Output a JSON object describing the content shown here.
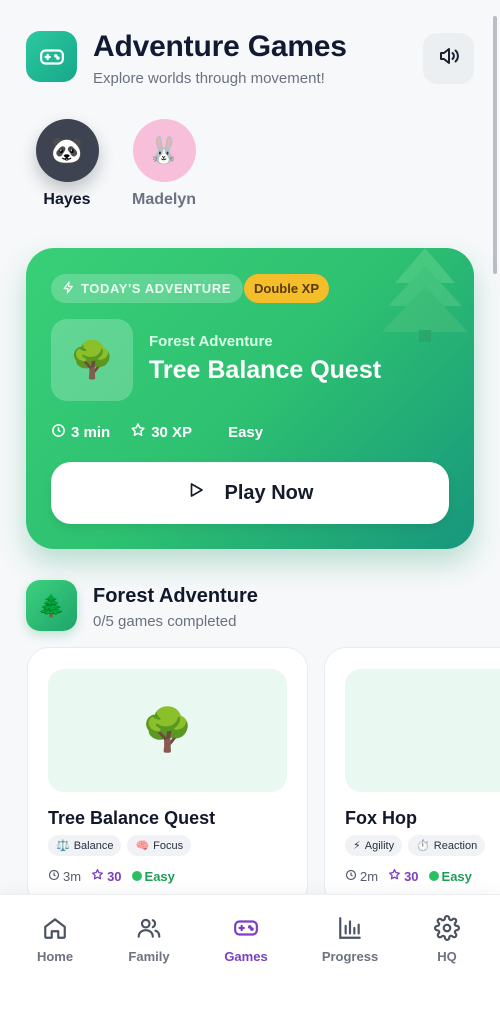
{
  "header": {
    "title": "Adventure Games",
    "subtitle": "Explore worlds through movement!",
    "app_icon": "gamepad-icon",
    "sound_icon": "speaker-icon"
  },
  "profiles": [
    {
      "name": "Hayes",
      "avatar": "🐼",
      "active": true
    },
    {
      "name": "Madelyn",
      "avatar": "🐰",
      "active": false
    }
  ],
  "hero": {
    "badge": "TODAY'S ADVENTURE",
    "bonus": "Double XP",
    "thumb": "🌳",
    "category": "Forest Adventure",
    "title": "Tree Balance Quest",
    "duration": "3 min",
    "xp": "30 XP",
    "difficulty": "Easy",
    "play_label": "Play Now"
  },
  "section": {
    "icon": "🌲",
    "title": "Forest Adventure",
    "progress": "0/5 games completed"
  },
  "games": [
    {
      "thumb": "🌳",
      "title": "Tree Balance Quest",
      "tags": [
        {
          "icon": "⚖️",
          "label": "Balance"
        },
        {
          "icon": "🧠",
          "label": "Focus"
        }
      ],
      "duration": "3m",
      "xp": "30",
      "difficulty": "Easy"
    },
    {
      "thumb": "🦊",
      "title": "Fox Hop",
      "tags": [
        {
          "icon": "⚡",
          "label": "Agility"
        },
        {
          "icon": "⏱️",
          "label": "Reaction"
        }
      ],
      "duration": "2m",
      "xp": "30",
      "difficulty": "Easy"
    }
  ],
  "nav": [
    {
      "label": "Home",
      "icon": "home-icon",
      "active": false
    },
    {
      "label": "Family",
      "icon": "family-icon",
      "active": false
    },
    {
      "label": "Games",
      "icon": "gamepad-icon",
      "active": true
    },
    {
      "label": "Progress",
      "icon": "chart-icon",
      "active": false
    },
    {
      "label": "HQ",
      "icon": "gear-icon",
      "active": false
    }
  ],
  "colors": {
    "accent": "#7b3fc4",
    "hero_green": "#2ec171",
    "xp_badge": "#f4bd2a",
    "easy": "#2bbf63"
  }
}
